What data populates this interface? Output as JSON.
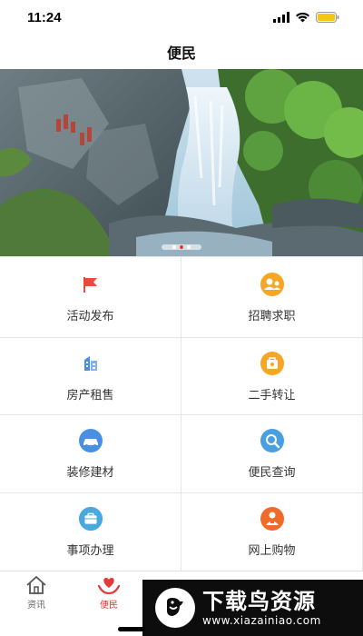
{
  "status": {
    "time": "11:24"
  },
  "nav": {
    "title": "便民"
  },
  "banner": {
    "image": "waterfall-photo",
    "slide_count": 3,
    "active_slide": 2
  },
  "grid": {
    "items": [
      {
        "label": "活动发布",
        "icon": "flag-icon",
        "color": "#e84a3c"
      },
      {
        "label": "招聘求职",
        "icon": "recruit-icon",
        "color": "#f5a623"
      },
      {
        "label": "房产租售",
        "icon": "building-icon",
        "color": "#4a90e2"
      },
      {
        "label": "二手转让",
        "icon": "trade-icon",
        "color": "#f5a623"
      },
      {
        "label": "装修建材",
        "icon": "car-icon",
        "color": "#4a90e2"
      },
      {
        "label": "便民查询",
        "icon": "search-icon",
        "color": "#4a9fe0"
      },
      {
        "label": "事项办理",
        "icon": "briefcase-icon",
        "color": "#4aa8e0"
      },
      {
        "label": "网上购物",
        "icon": "shopper-icon",
        "color": "#f06a2a"
      }
    ]
  },
  "tabs": [
    {
      "label": "资讯",
      "icon": "home-icon",
      "active": false
    },
    {
      "label": "便民",
      "icon": "heart-hands-icon",
      "active": true
    }
  ],
  "watermark": {
    "brand": "下载鸟资源",
    "url": "www.xiazainiao.com"
  },
  "colors": {
    "accent": "#e23a3a",
    "divider": "#e6e6e6"
  }
}
